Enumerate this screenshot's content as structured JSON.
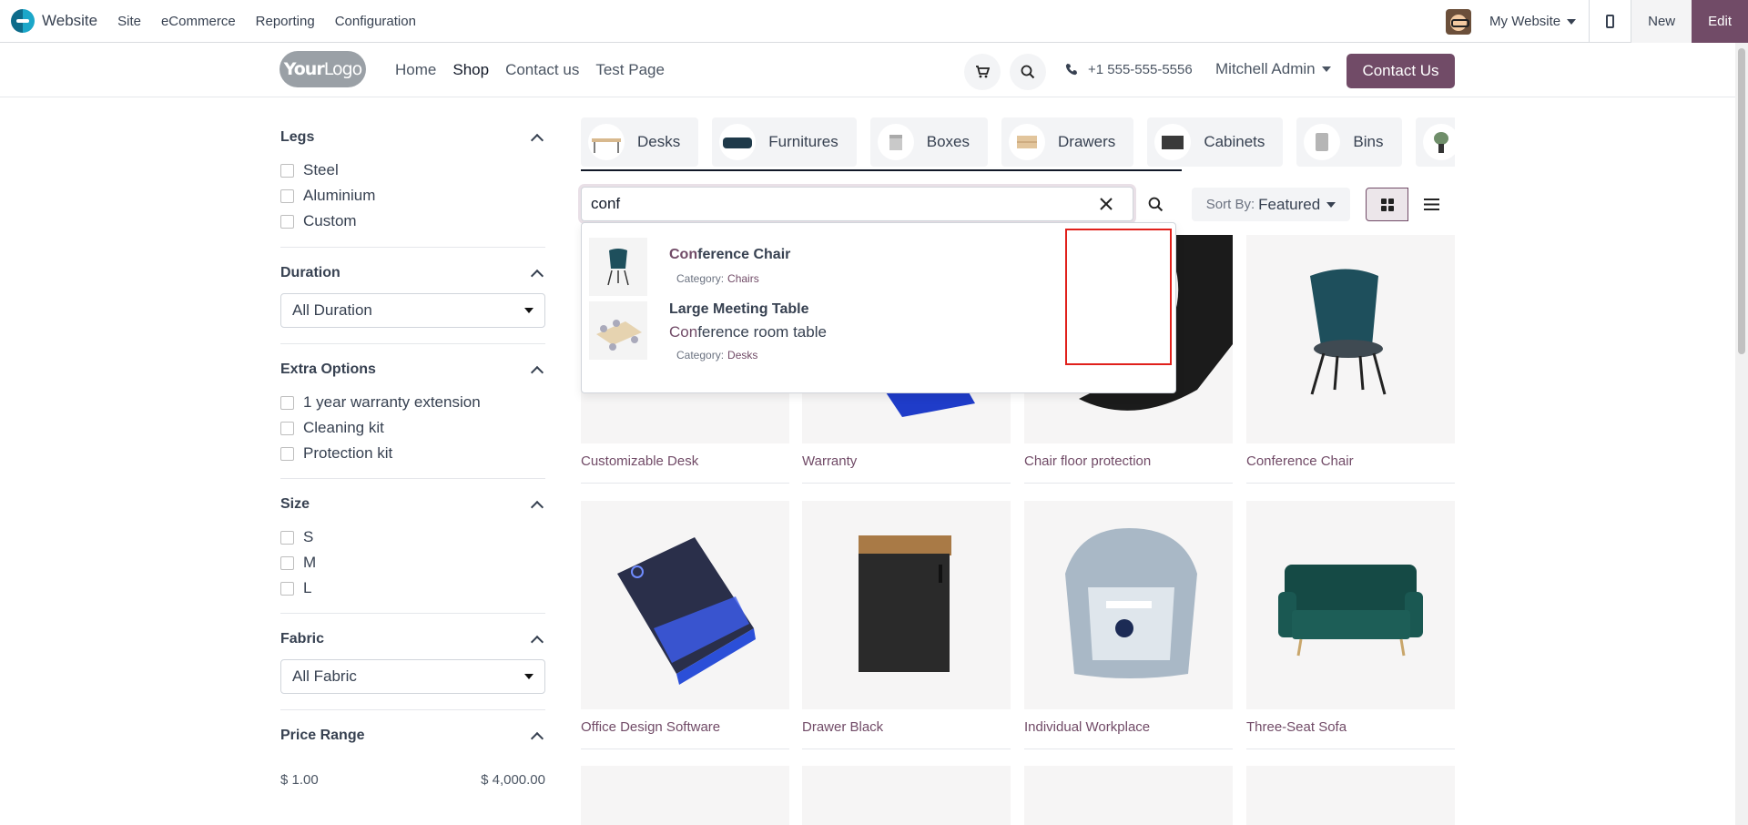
{
  "topbar": {
    "brand": "Website",
    "menu": [
      "Site",
      "eCommerce",
      "Reporting",
      "Configuration"
    ],
    "site_selector": "My Website",
    "new_label": "New",
    "edit_label": "Edit"
  },
  "header": {
    "logo_bold": "Your",
    "logo_light": "Logo",
    "nav": [
      "Home",
      "Shop",
      "Contact us",
      "Test Page"
    ],
    "active_nav": "Shop",
    "phone": "+1 555-555-5556",
    "user": "Mitchell Admin",
    "contact_button": "Contact Us"
  },
  "filters": {
    "legs": {
      "title": "Legs",
      "options": [
        "Steel",
        "Aluminium",
        "Custom"
      ]
    },
    "duration": {
      "title": "Duration",
      "selected": "All Duration"
    },
    "extra": {
      "title": "Extra Options",
      "options": [
        "1 year warranty extension",
        "Cleaning kit",
        "Protection kit"
      ]
    },
    "size": {
      "title": "Size",
      "options": [
        "S",
        "M",
        "L"
      ]
    },
    "fabric": {
      "title": "Fabric",
      "selected": "All Fabric"
    },
    "price": {
      "title": "Price Range",
      "min": "$ 1.00",
      "max": "$ 4,000.00"
    }
  },
  "categories": [
    "Desks",
    "Furnitures",
    "Boxes",
    "Drawers",
    "Cabinets",
    "Bins"
  ],
  "search": {
    "value": "conf",
    "sort_label": "Sort By:",
    "sort_value": "Featured"
  },
  "autocomplete": [
    {
      "title_hl": "Con",
      "title_rest": "ference Chair",
      "category_label": "Category:",
      "category": "Chairs"
    },
    {
      "title": "Large Meeting Table",
      "desc_hl": "Con",
      "desc_rest": "ference room table",
      "category_label": "Category:",
      "category": "Desks"
    }
  ],
  "products": [
    "Customizable Desk",
    "Warranty",
    "Chair floor protection",
    "Conference Chair",
    "Office Design Software",
    "Drawer Black",
    "Individual Workplace",
    "Three-Seat Sofa"
  ],
  "colors": {
    "brand": "#714b67",
    "highlight_border": "#e0201b"
  }
}
